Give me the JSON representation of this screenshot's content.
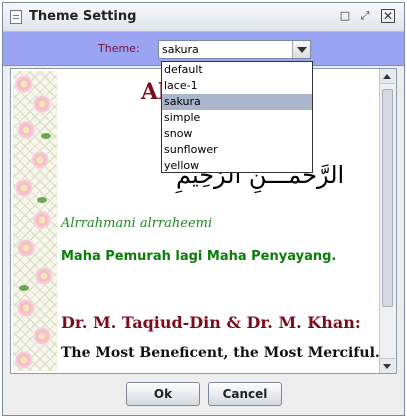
{
  "window": {
    "title": "Theme Setting",
    "controls": {
      "minimize": "□",
      "maximize": "⤢",
      "close": "✕"
    }
  },
  "theme": {
    "label": "Theme:",
    "selected": "sakura",
    "options": [
      "default",
      "lace-1",
      "sakura",
      "simple",
      "snow",
      "sunflower",
      "yellow"
    ]
  },
  "preview": {
    "title": "Al",
    "arabic": "الرَّحْمَـــنِ الرَّحِيمِ",
    "transliteration": "Alrrahmani alrraheemi",
    "malay": "Maha Pemurah lagi Maha Penyayang.",
    "authors": "Dr. M. Taqiud-Din & Dr. M. Khan:",
    "english": "The Most Beneficent, the Most Merciful."
  },
  "buttons": {
    "ok": "Ok",
    "cancel": "Cancel"
  },
  "colors": {
    "theme_bar": "#9aa4f2",
    "title_maroon": "#7d0b1c",
    "green_text": "#0a7d0a",
    "selected_row": "#a9b6cb"
  }
}
